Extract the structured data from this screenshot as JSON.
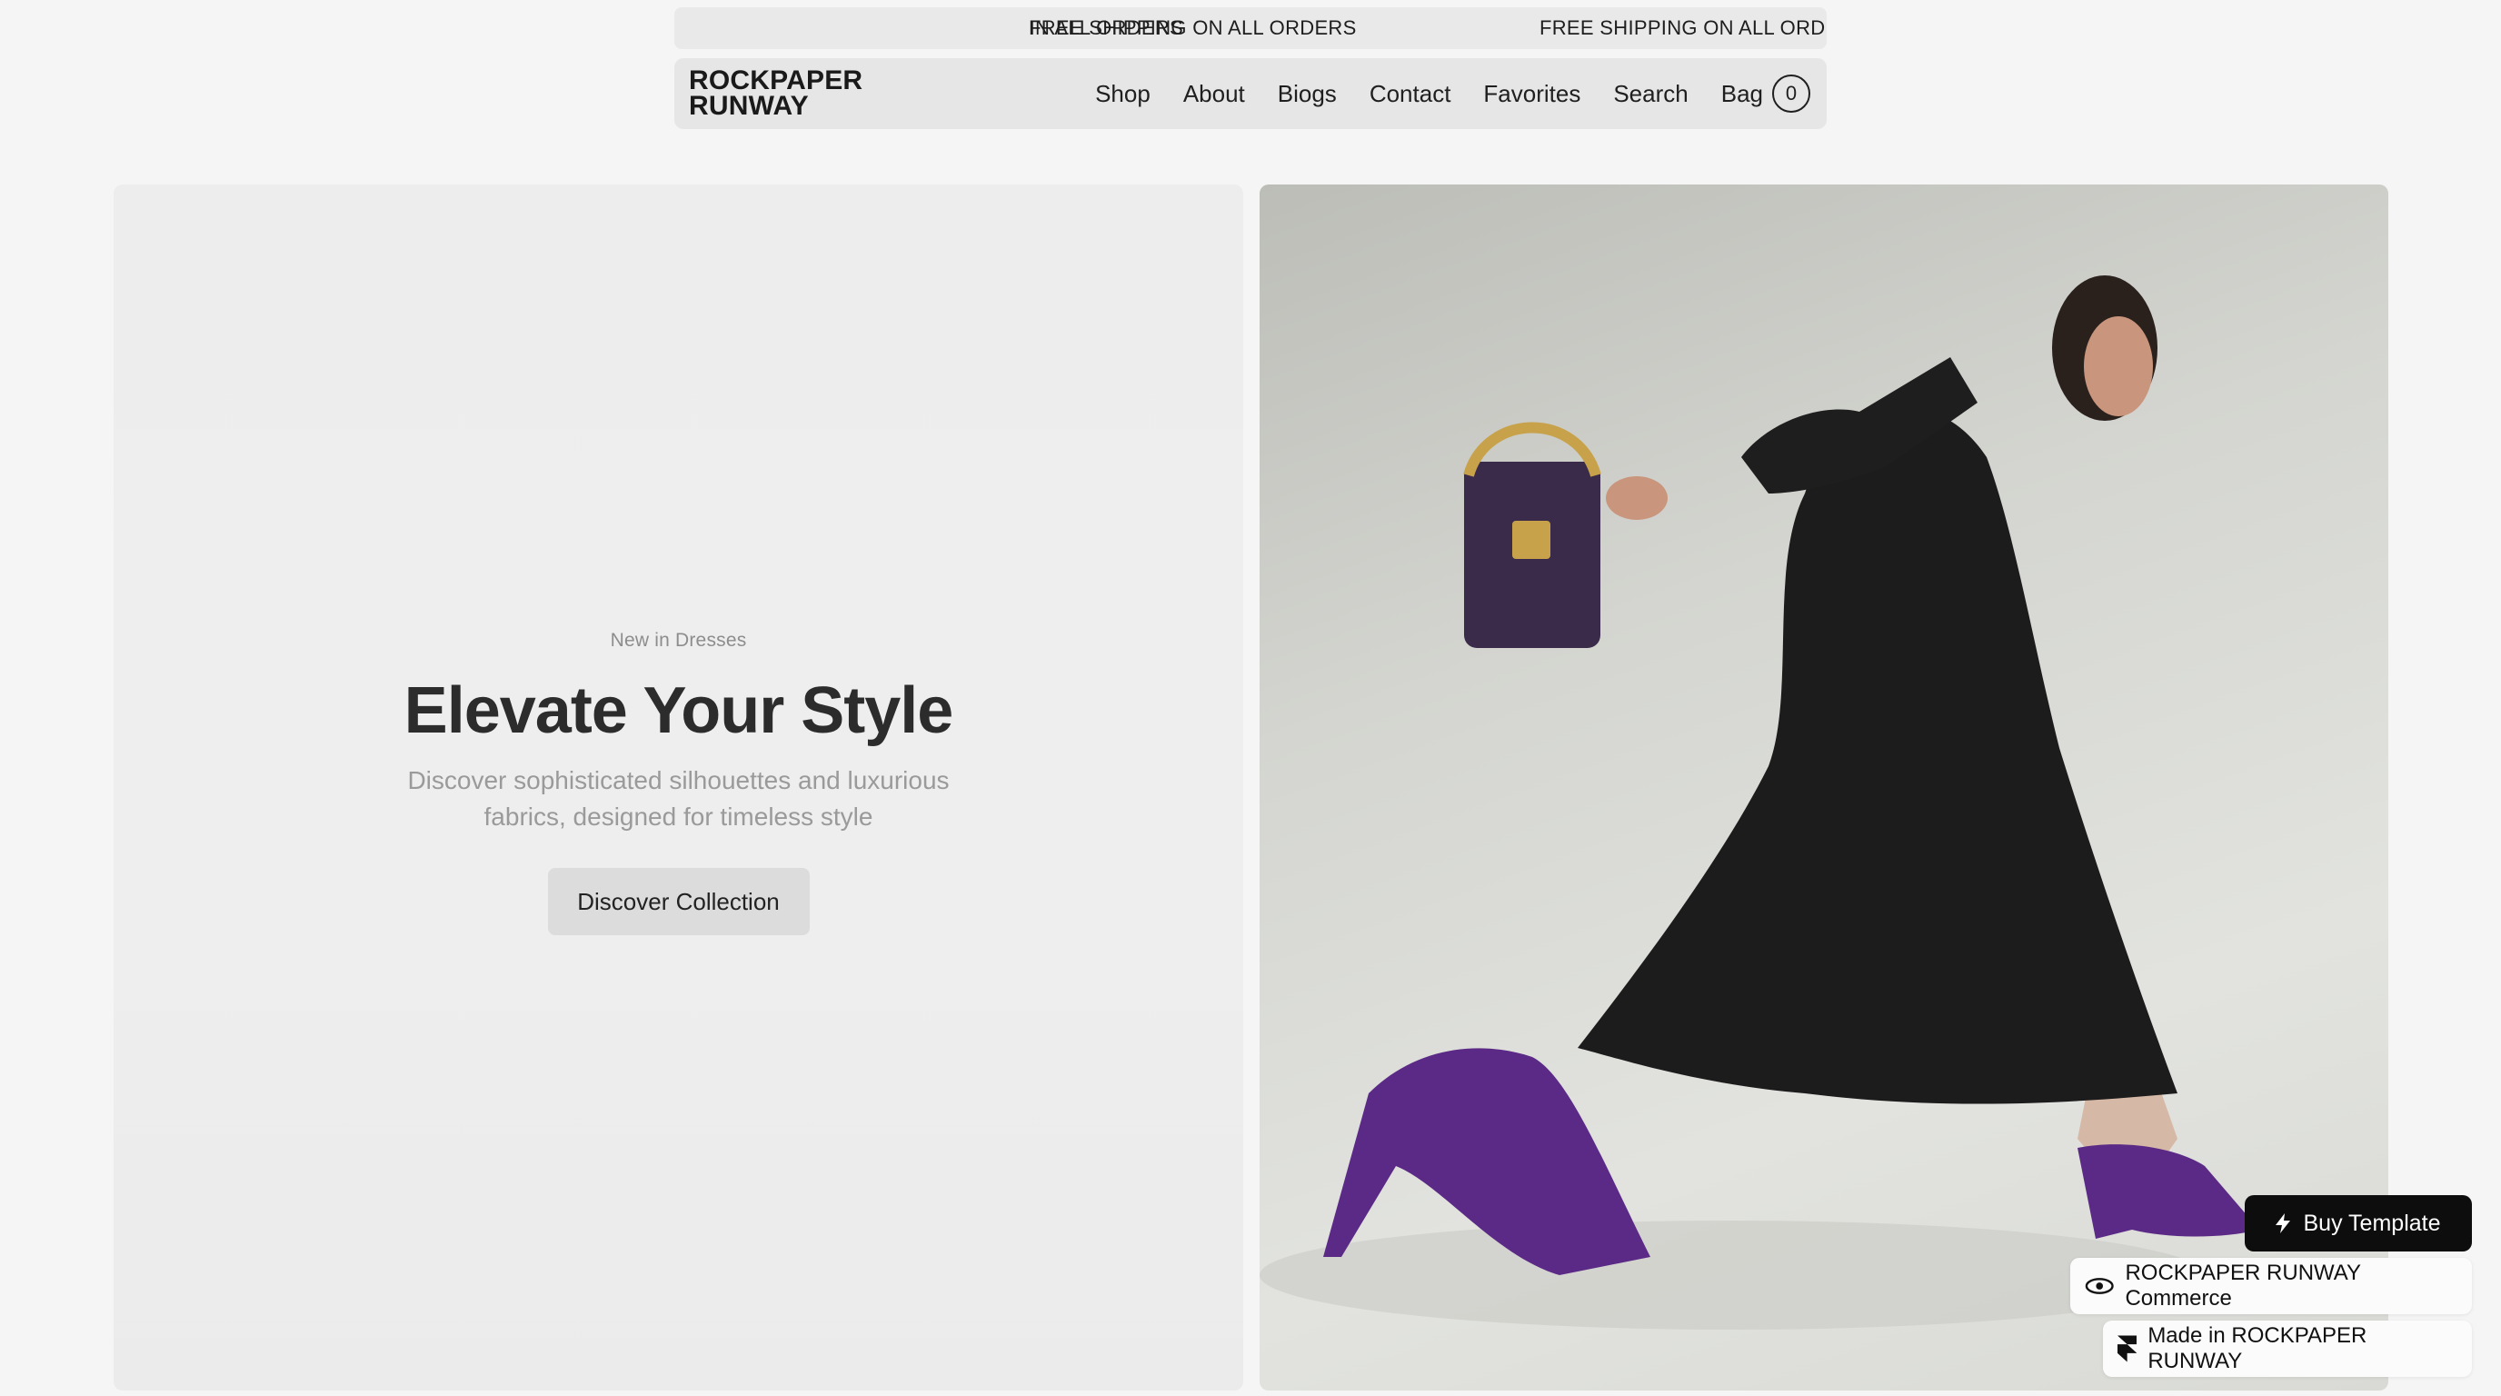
{
  "ticker": {
    "items": [
      "IN ALL ORDERS",
      "FREE SHIPPING ON ALL ORDERS",
      "FREE SHIPPING ON ALL ORDERS"
    ]
  },
  "nav": {
    "logo_line1": "ROCKPAPER",
    "logo_line2": "RUNWAY",
    "links": [
      "Shop",
      "About",
      "Biogs",
      "Contact",
      "Favorites",
      "Search"
    ],
    "bag_label": "Bag",
    "bag_count": "0"
  },
  "hero": {
    "eyebrow": "New in Dresses",
    "title": "Elevate Your Style",
    "description": "Discover sophisticated silhouettes and luxurious fabrics, designed for timeless style",
    "cta_label": "Discover Collection"
  },
  "floating": {
    "buy_label": "Buy Template",
    "commerce_label": "ROCKPAPER RUNWAY Commerce",
    "made_label": "Made in ROCKPAPER RUNWAY"
  },
  "colors": {
    "background": "#f5f5f5",
    "panel": "#ededed",
    "dress": "#1b1b1b",
    "shoe_purple": "#5b2a86",
    "bag_purple": "#3a2b4a",
    "gold": "#c8a24a"
  },
  "icons": {
    "buy": "lightning-icon",
    "commerce": "eye-logo-icon",
    "made": "framer-logo-icon",
    "bag": "bag-count-badge"
  }
}
